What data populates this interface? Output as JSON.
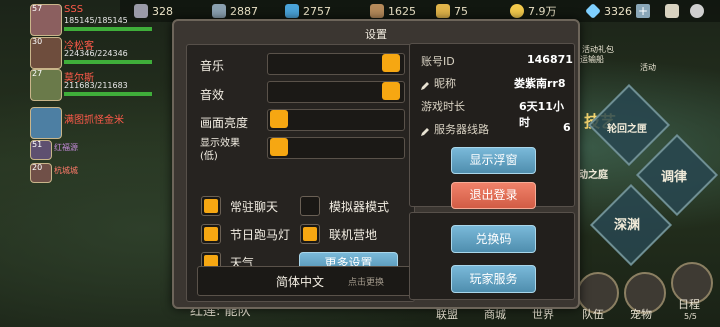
{
  "top_bar": {
    "resources": [
      {
        "icon": "stone-icon",
        "value": "328",
        "color": "#9a9aa8"
      },
      {
        "icon": "iron-icon",
        "value": "2887",
        "color": "#8aa0b0"
      },
      {
        "icon": "crystal-icon",
        "value": "2757",
        "color": "#4aa3d9"
      },
      {
        "icon": "wood-icon",
        "value": "1625",
        "color": "#b58a5a"
      },
      {
        "icon": "wheat-icon",
        "value": "75",
        "color": "#e0b44a"
      },
      {
        "icon": "gold-coin-icon",
        "value": "7.9万",
        "color": "#f2c94c"
      },
      {
        "icon": "diamond-icon",
        "value": "3326",
        "color": "#7fd0ff"
      }
    ]
  },
  "team": [
    {
      "level": "57",
      "name": "SSS",
      "hp": "185145/185145"
    },
    {
      "level": "30",
      "name": "冷松客",
      "hp": "224346/224346"
    },
    {
      "level": "27",
      "name": "莫尔斯",
      "hp": "211683/211683"
    },
    {
      "level": "",
      "name": "满图抓怪金米",
      "hp": ""
    },
    {
      "level": "51",
      "name": "红福源",
      "hp": ""
    },
    {
      "level": "20",
      "name": "杭城城",
      "hp": ""
    }
  ],
  "modal": {
    "title": "设置",
    "music_label": "音乐",
    "sound_label": "音效",
    "brightness_label": "画面亮度",
    "display_label_1": "显示效果",
    "display_label_2": "(低)",
    "checks": {
      "chat": "常驻聊天",
      "emulator": "模拟器模式",
      "marquee": "节日跑马灯",
      "camp": "联机营地",
      "weather": "天气"
    },
    "more_settings": "更多设置",
    "language": "简体中文",
    "language_change": "点击更换"
  },
  "account": {
    "id_label": "账号ID",
    "id_value": "146871",
    "nick_label": "昵称",
    "nick_value": "娄紫南rr8",
    "time_label": "游戏时长",
    "time_value": "6天11小时",
    "server_label": "服务器线路",
    "server_value": "6",
    "show_float": "显示浮窗",
    "logout": "退出登录",
    "redeem": "兑换码",
    "service": "玩家服务"
  },
  "map_buttons": {
    "reincarnation": "轮回之匣",
    "yard": "动之庭",
    "harmony": "调律",
    "abyss": "深渊",
    "tech": "技艺",
    "activity_gift": "活动礼包",
    "activity": "活动",
    "ferry": "运输船"
  },
  "bottom_nav": {
    "chat_text": "红莲: 能队",
    "items": [
      "联盟",
      "商城",
      "世界",
      "队伍",
      "宠物",
      "日程"
    ],
    "page": "5/5"
  }
}
